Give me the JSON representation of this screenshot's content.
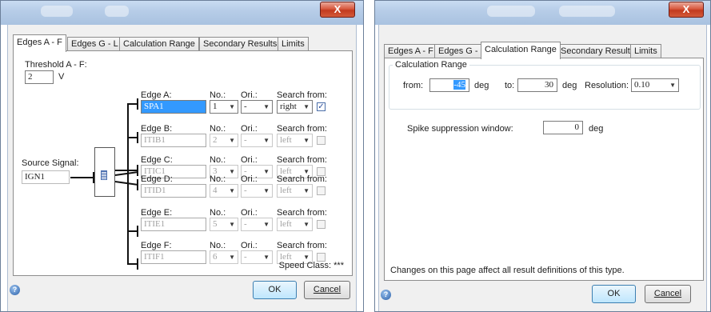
{
  "left_dialog": {
    "close_glyph": "X",
    "tabs": [
      "Edges A - F",
      "Edges G - L",
      "Calculation Range",
      "Secondary Results",
      "Limits"
    ],
    "active_tab": 0,
    "threshold": {
      "label": "Threshold A - F:",
      "value": "2",
      "unit": "V"
    },
    "source": {
      "label": "Source Signal:",
      "value": "IGN1"
    },
    "columns": {
      "no": "No.:",
      "ori": "Ori.:",
      "search": "Search from:"
    },
    "edges": [
      {
        "label": "Edge A:",
        "name": "SPA1",
        "no": "1",
        "ori": "-",
        "search": "right",
        "checked": true,
        "enabled": true
      },
      {
        "label": "Edge B:",
        "name": "ITIB1",
        "no": "2",
        "ori": "-",
        "search": "left",
        "checked": false,
        "enabled": false
      },
      {
        "label": "Edge C:",
        "name": "ITIC1",
        "no": "3",
        "ori": "-",
        "search": "left",
        "checked": false,
        "enabled": false
      },
      {
        "label": "Edge D:",
        "name": "ITID1",
        "no": "4",
        "ori": "-",
        "search": "left",
        "checked": false,
        "enabled": false
      },
      {
        "label": "Edge E:",
        "name": "ITIE1",
        "no": "5",
        "ori": "-",
        "search": "left",
        "checked": false,
        "enabled": false
      },
      {
        "label": "Edge F:",
        "name": "ITIF1",
        "no": "6",
        "ori": "-",
        "search": "left",
        "checked": false,
        "enabled": false
      }
    ],
    "speed_class": "Speed Class: ***",
    "help_glyph": "?",
    "ok": "OK",
    "cancel": "Cancel"
  },
  "right_dialog": {
    "close_glyph": "X",
    "tabs": [
      "Edges A - F",
      "Edges G - L",
      "Calculation Range",
      "Secondary Results",
      "Limits"
    ],
    "active_tab": 2,
    "group_title": "Calculation Range",
    "from_label": "from:",
    "from_value": "-45",
    "from_unit": "deg",
    "to_label": "to:",
    "to_value": "30",
    "to_unit": "deg",
    "resolution_label": "Resolution:",
    "resolution_value": "0.10",
    "spike_label": "Spike suppression window:",
    "spike_value": "0",
    "spike_unit": "deg",
    "note": "Changes on this page affect all result definitions of this type.",
    "help_glyph": "?",
    "ok": "OK",
    "cancel": "Cancel"
  },
  "colors": {
    "selection": "#3399ff",
    "titlebar": "#b7cde8",
    "close": "#c23a1e"
  }
}
